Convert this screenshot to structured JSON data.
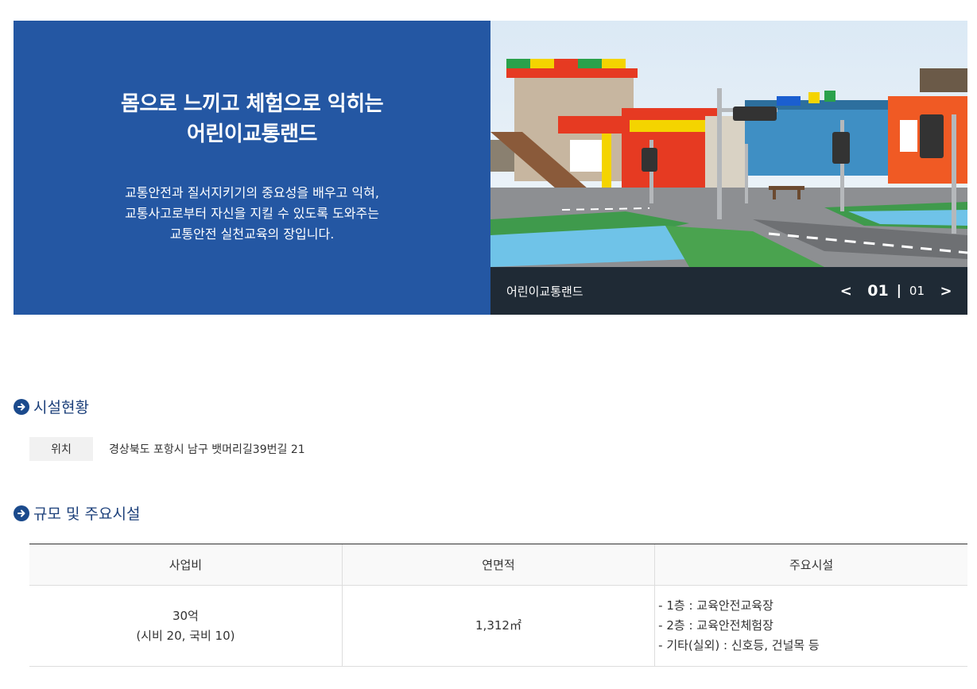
{
  "hero": {
    "title_line1": "몸으로 느끼고 체험으로 익히는",
    "title_line2": "어린이교통랜드",
    "desc_line1": "교통안전과 질서지키기의 중요성을 배우고 익혀,",
    "desc_line2": "교통사고로부터 자신을 지킬 수 있도록 도와주는",
    "desc_line3": "교통안전 실천교육의 장입니다.",
    "caption": "어린이교통랜드",
    "prev": "<",
    "next": ">",
    "current": "01",
    "separator": "|",
    "total": "01"
  },
  "facility": {
    "title": "시설현황",
    "location_label": "위치",
    "location_value": "경상북도 포항시 남구 뱃머리길39번길 21"
  },
  "scale": {
    "title": "규모 및 주요시설",
    "headers": [
      "사업비",
      "연면적",
      "주요시설"
    ],
    "cost_line1": "30억",
    "cost_line2": "(시비 20, 국비 10)",
    "area": "1,312㎡",
    "facilities": [
      "- 1층 : 교육안전교육장",
      "- 2층 : 교육안전체험장",
      "- 기타(실외) : 신호등, 건널목 등"
    ]
  },
  "colors": {
    "hero_bg": "#2457a3",
    "caption_bg": "#1f2a35",
    "accent": "#1b4a8c"
  }
}
